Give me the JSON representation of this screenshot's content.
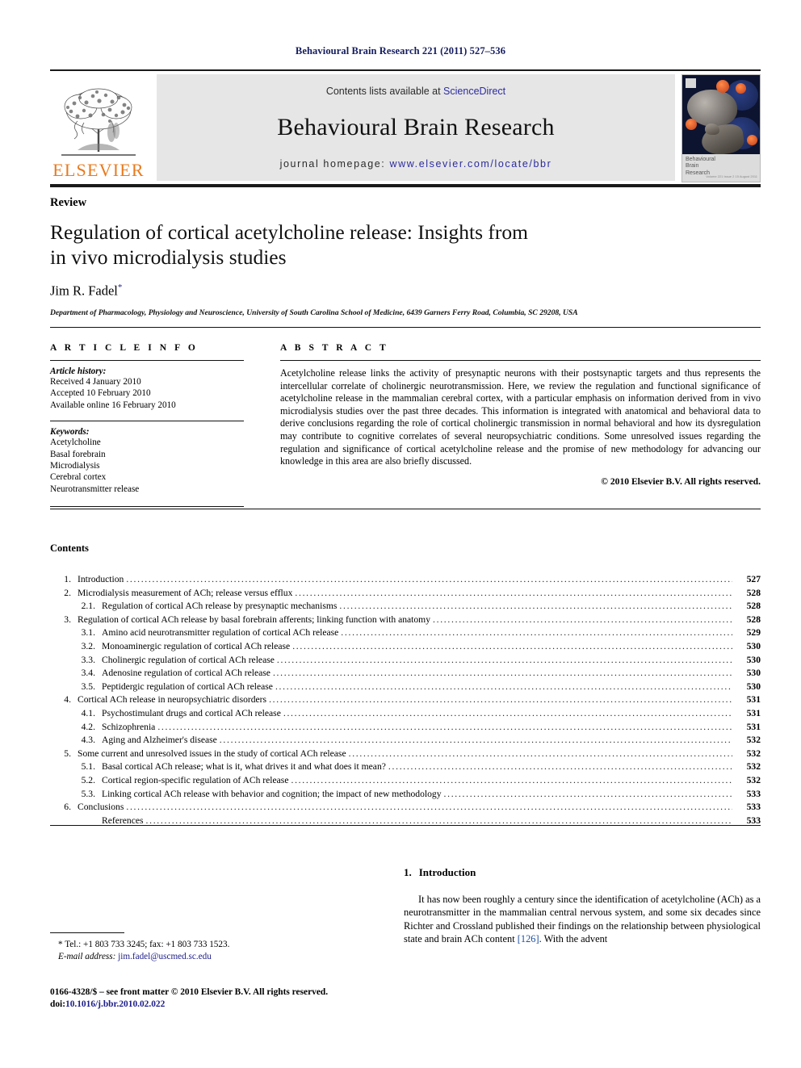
{
  "running_head": "Behavioural Brain Research 221 (2011) 527–536",
  "masthead": {
    "contents_line_prefix": "Contents lists available at ",
    "sciencedirect": "ScienceDirect",
    "journal_title": "Behavioural Brain Research",
    "homepage_label": "journal homepage:",
    "homepage_url": "www.elsevier.com/locate/bbr",
    "publisher_logo_text": "ELSEVIER",
    "cover_label": "Behavioural\nBrain\nResearch",
    "cover_label_line1": "Behavioural",
    "cover_label_line2": "Brain",
    "cover_label_line3": "Research",
    "cover_issue_text": "Volume 221 Issue 2 15 August 2011"
  },
  "article": {
    "type": "Review",
    "title_line1": "Regulation of cortical acetylcholine release: Insights from",
    "title_line2": "in vivo microdialysis studies",
    "author": "Jim R. Fadel",
    "author_marker": "*",
    "affiliation": "Department of Pharmacology, Physiology and Neuroscience, University of South Carolina School of Medicine, 6439 Garners Ferry Road, Columbia, SC 29208, USA"
  },
  "article_info": {
    "heading": "A R T I C L E   I N F O",
    "history_label": "Article history:",
    "history": [
      "Received 4 January 2010",
      "Accepted 10 February 2010",
      "Available online 16 February 2010"
    ],
    "keywords_label": "Keywords:",
    "keywords": [
      "Acetylcholine",
      "Basal forebrain",
      "Microdialysis",
      "Cerebral cortex",
      "Neurotransmitter release"
    ]
  },
  "abstract": {
    "heading": "A B S T R A C T",
    "text": "Acetylcholine release links the activity of presynaptic neurons with their postsynaptic targets and thus represents the intercellular correlate of cholinergic neurotransmission. Here, we review the regulation and functional significance of acetylcholine release in the mammalian cerebral cortex, with a particular emphasis on information derived from in vivo microdialysis studies over the past three decades. This information is integrated with anatomical and behavioral data to derive conclusions regarding the role of cortical cholinergic transmission in normal behavioral and how its dysregulation may contribute to cognitive correlates of several neuropsychiatric conditions. Some unresolved issues regarding the regulation and significance of cortical acetylcholine release and the promise of new methodology for advancing our knowledge in this area are also briefly discussed.",
    "copyright": "© 2010 Elsevier B.V. All rights reserved."
  },
  "contents": {
    "heading": "Contents",
    "items": [
      {
        "num": "1.",
        "label": "Introduction",
        "page": "527",
        "level": 1
      },
      {
        "num": "2.",
        "label": "Microdialysis measurement of ACh; release versus efflux",
        "page": "528",
        "level": 1
      },
      {
        "num": "2.1.",
        "label": "Regulation of cortical ACh release by presynaptic mechanisms",
        "page": "528",
        "level": 2
      },
      {
        "num": "3.",
        "label": "Regulation of cortical ACh release by basal forebrain afferents; linking function with anatomy",
        "page": "528",
        "level": 1
      },
      {
        "num": "3.1.",
        "label": "Amino acid neurotransmitter regulation of cortical ACh release",
        "page": "529",
        "level": 2
      },
      {
        "num": "3.2.",
        "label": "Monoaminergic regulation of cortical ACh release",
        "page": "530",
        "level": 2
      },
      {
        "num": "3.3.",
        "label": "Cholinergic regulation of cortical ACh release",
        "page": "530",
        "level": 2
      },
      {
        "num": "3.4.",
        "label": "Adenosine regulation of cortical ACh release",
        "page": "530",
        "level": 2
      },
      {
        "num": "3.5.",
        "label": "Peptidergic regulation of cortical ACh release",
        "page": "530",
        "level": 2
      },
      {
        "num": "4.",
        "label": "Cortical ACh release in neuropsychiatric disorders",
        "page": "531",
        "level": 1
      },
      {
        "num": "4.1.",
        "label": "Psychostimulant drugs and cortical ACh release",
        "page": "531",
        "level": 2
      },
      {
        "num": "4.2.",
        "label": "Schizophrenia",
        "page": "531",
        "level": 2
      },
      {
        "num": "4.3.",
        "label": "Aging and Alzheimer's disease",
        "page": "532",
        "level": 2
      },
      {
        "num": "5.",
        "label": "Some current and unresolved issues in the study of cortical ACh release",
        "page": "532",
        "level": 1
      },
      {
        "num": "5.1.",
        "label": "Basal cortical ACh release; what is it, what drives it and what does it mean?",
        "page": "532",
        "level": 2
      },
      {
        "num": "5.2.",
        "label": "Cortical region-specific regulation of ACh release",
        "page": "532",
        "level": 2
      },
      {
        "num": "5.3.",
        "label": "Linking cortical ACh release with behavior and cognition; the impact of new methodology",
        "page": "533",
        "level": 2
      },
      {
        "num": "6.",
        "label": "Conclusions",
        "page": "533",
        "level": 1
      },
      {
        "num": "",
        "label": "References",
        "page": "533",
        "level": 2
      }
    ]
  },
  "introduction": {
    "number": "1.",
    "heading": "Introduction",
    "paragraph_before_cite": "It has now been roughly a century since the identification of acetylcholine (ACh) as a neurotransmitter in the mammalian central nervous system, and some six decades since Richter and Crossland published their findings on the relationship between physiological state and brain ACh content ",
    "citation": "[126]",
    "paragraph_after_cite": ". With the advent"
  },
  "footer": {
    "corresponding_marker": "*",
    "tel_fax": "Tel.: +1 803 733 3245; fax: +1 803 733 1523.",
    "email_label": "E-mail address:",
    "email": "jim.fadel@uscmed.sc.edu",
    "issn_line": "0166-4328/$ – see front matter © 2010 Elsevier B.V. All rights reserved.",
    "doi_label": "doi:",
    "doi": "10.1016/j.bbr.2010.02.022"
  },
  "colors": {
    "runhead_blue": "#141c5e",
    "link_blue": "#2c2ca0",
    "cite_blue": "#1c4fa0",
    "elsevier_orange": "#e87a1e",
    "masthead_gray": "#e6e6e6"
  }
}
